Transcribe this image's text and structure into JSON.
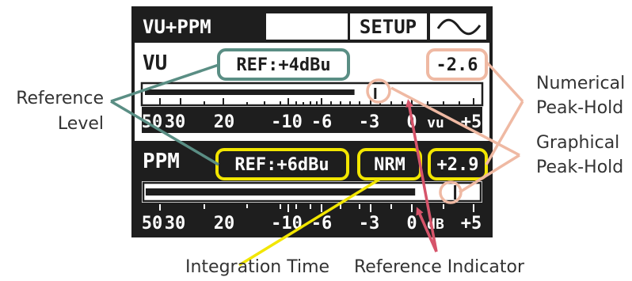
{
  "display": {
    "header": {
      "mode_label": "VU+PPM",
      "setup_button": "SETUP",
      "wave_icon": "sine-wave-icon"
    },
    "vu": {
      "label": "VU",
      "reference": "REF:+4dBu",
      "peak_value": "-2.6",
      "bar_level_fraction": 0.63,
      "peak_hold_fraction": 0.69,
      "scale": [
        "50",
        "30",
        "20",
        "-10",
        "-6",
        "-3",
        "0",
        "vu",
        "+5"
      ]
    },
    "ppm": {
      "label": "PPM",
      "reference": "REF:+6dBu",
      "integration": "NRM",
      "peak_value": "+2.9",
      "bar_level_fraction": 0.81,
      "peak_hold_fraction": 0.93,
      "scale": [
        "50",
        "30",
        "20",
        "-10",
        "-6",
        "-3",
        "0",
        "dB",
        "+5"
      ]
    }
  },
  "annotations": {
    "reference_level": [
      "Reference",
      "Level"
    ],
    "numerical_peak_hold": [
      "Numerical",
      "Peak-Hold"
    ],
    "graphical_peak_hold": [
      "Graphical",
      "Peak-Hold"
    ],
    "integration_time": "Integration Time",
    "reference_indicator": "Reference Indicator"
  },
  "colors": {
    "lcd_dark": "#1e1e1e",
    "reference_callout": "#5a8e84",
    "peak_hold_callout": "#efb9a3",
    "integration_callout": "#f2e600",
    "reference_indicator_arrow": "#d6546a"
  }
}
